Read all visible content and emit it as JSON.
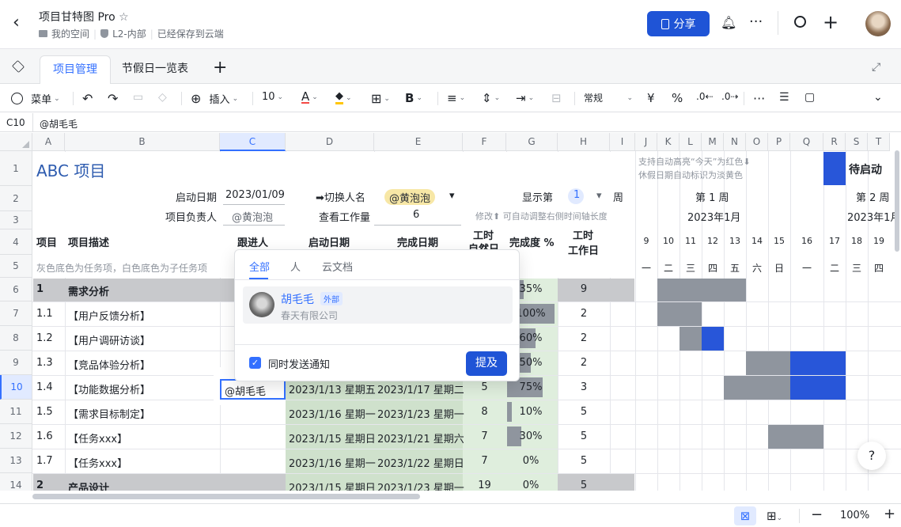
{
  "header": {
    "title": "项目甘特图 Pro",
    "breadcrumb_space": "我的空间",
    "breadcrumb_security": "L2-内部",
    "save_status": "已经保存到云端",
    "share_label": "分享"
  },
  "tabs": [
    "项目管理",
    "节假日一览表"
  ],
  "toolbar": {
    "menu": "菜单",
    "insert": "插入",
    "font_size": "10",
    "text_color_glyph": "A",
    "bold_glyph": "B",
    "number_format": "常规",
    "currency": "¥",
    "percent": "%"
  },
  "formula_bar": {
    "ref": "C10",
    "value": "@胡毛毛"
  },
  "columns": [
    "A",
    "B",
    "C",
    "D",
    "E",
    "F",
    "G",
    "H",
    "I",
    "J",
    "K",
    "L",
    "M",
    "N",
    "O",
    "P",
    "Q",
    "R",
    "S",
    "T"
  ],
  "rows": [
    "1",
    "2",
    "3",
    "4",
    "5",
    "6",
    "7",
    "8",
    "9",
    "10",
    "11",
    "12",
    "13",
    "14"
  ],
  "sheet": {
    "title": "ABC 项目",
    "note1": "支持自动高亮“今天”为红色⬇",
    "note2": "休假日期自动标识为淡黄色",
    "status_label": "待启动",
    "start_date_label": "启动日期",
    "start_date_value": "2023/01/09",
    "switch_label": "➡切换人名",
    "switch_value": "@黄泡泡",
    "show_label": "显示第",
    "show_value": "1",
    "week_label": "周",
    "owner_label": "项目负责人",
    "owner_value": "@黄泡泡",
    "workload_label": "查看工作量",
    "workload_value": "6",
    "modify_hint": "修改⬆ 可自动调整右侧时间轴长度",
    "week1": "第 1 周",
    "week2": "第 2 周",
    "month1": "2023年1月",
    "month2": "2023年1月",
    "hdr_item": "项目",
    "hdr_desc": "项目描述",
    "hdr_follow": "跟进人",
    "hdr_start": "启动日期",
    "hdr_end": "完成日期",
    "hdr_natural_1": "工时",
    "hdr_natural_2": "自然日",
    "hdr_progress": "完成度 %",
    "hdr_work_1": "工时",
    "hdr_work_2": "工作日",
    "legend_hint": "灰色底色为任务项，白色底色为子任务项",
    "days": [
      "9",
      "10",
      "11",
      "12",
      "13",
      "14",
      "15",
      "16",
      "17",
      "18",
      "19"
    ],
    "weekdays": [
      "一",
      "二",
      "三",
      "四",
      "五",
      "六",
      "日",
      "一",
      "二",
      "三",
      "四"
    ],
    "tasks": [
      {
        "id": "1",
        "desc": "需求分析",
        "start": "",
        "end": "",
        "natural": "",
        "progress": "35%",
        "progress_val": 0.35,
        "work": "9",
        "parent": true
      },
      {
        "id": "1.1",
        "desc": "【用户反馈分析】",
        "start": "",
        "end": "",
        "natural": "",
        "progress": "100%",
        "progress_val": 1.0,
        "work": "2",
        "parent": false
      },
      {
        "id": "1.2",
        "desc": "【用户调研访谈】",
        "start": "",
        "end": "",
        "natural": "",
        "progress": "60%",
        "progress_val": 0.6,
        "work": "2",
        "parent": false
      },
      {
        "id": "1.3",
        "desc": "【竞品体验分析】",
        "start": "",
        "end": "",
        "natural": "",
        "progress": "50%",
        "progress_val": 0.5,
        "work": "2",
        "parent": false
      },
      {
        "id": "1.4",
        "desc": "【功能数据分析】",
        "start": "2023/1/13 星期五",
        "end": "2023/1/17 星期二",
        "natural": "5",
        "progress": "75%",
        "progress_val": 0.75,
        "work": "3",
        "parent": false
      },
      {
        "id": "1.5",
        "desc": "【需求目标制定】",
        "start": "2023/1/16 星期一",
        "end": "2023/1/23 星期一",
        "natural": "8",
        "progress": "10%",
        "progress_val": 0.1,
        "work": "5",
        "parent": false
      },
      {
        "id": "1.6",
        "desc": "【任务xxx】",
        "start": "2023/1/15 星期日",
        "end": "2023/1/21 星期六",
        "natural": "7",
        "progress": "30%",
        "progress_val": 0.3,
        "work": "5",
        "parent": false
      },
      {
        "id": "1.7",
        "desc": "【任务xxx】",
        "start": "2023/1/16 星期一",
        "end": "2023/1/22 星期日",
        "natural": "7",
        "progress": "0%",
        "progress_val": 0,
        "work": "5",
        "parent": false
      },
      {
        "id": "2",
        "desc": "产品设计",
        "start": "2023/1/15 星期日",
        "end": "2023/1/23 星期一",
        "natural": "19",
        "progress": "0%",
        "progress_val": 0,
        "work": "5",
        "parent": true
      }
    ],
    "editing_cell": "@胡毛毛"
  },
  "popup": {
    "tabs": [
      "全部",
      "人",
      "云文档"
    ],
    "user_name": "胡毛毛",
    "user_tag": "外部",
    "user_company": "春天有限公司",
    "notify_label": "同时发送通知",
    "submit_label": "提及"
  },
  "statusbar": {
    "zoom": "100%"
  },
  "colors": {
    "accent": "#3370ff",
    "share_bg": "#1f54d6",
    "gantt_blue": "#2856d9",
    "gantt_gray": "#8f959e",
    "parent_row": "#c8c9cc"
  }
}
